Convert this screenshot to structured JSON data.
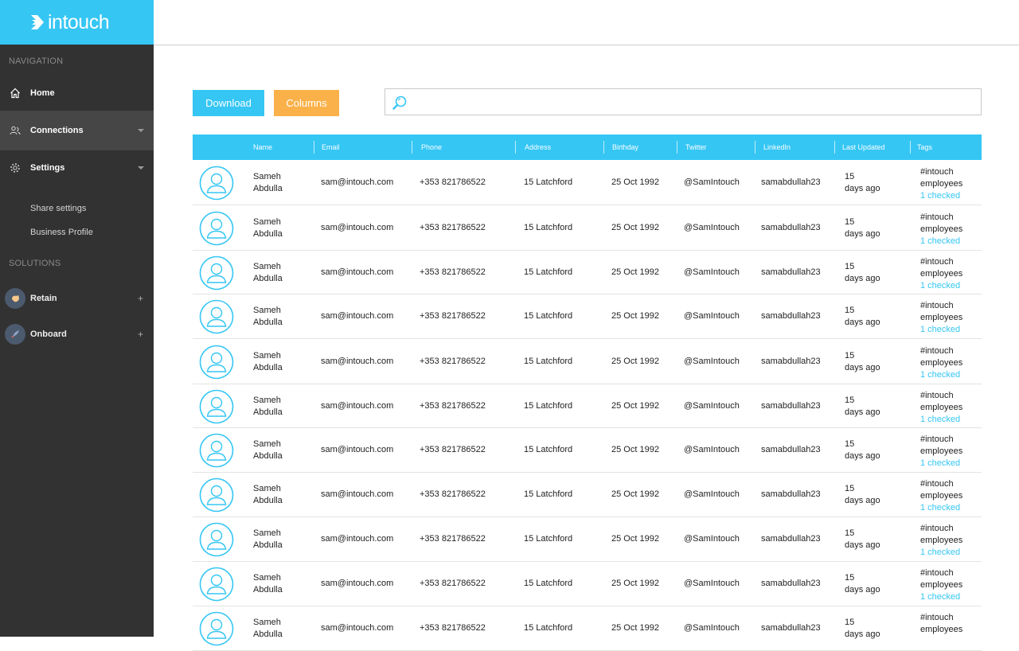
{
  "brand": {
    "name": "intouch"
  },
  "sidebar": {
    "nav_heading": "NAVIGATION",
    "items": [
      {
        "label": "Home",
        "icon": "home-icon"
      },
      {
        "label": "Connections",
        "icon": "connections-icon",
        "expandable": true
      },
      {
        "label": "Settings",
        "icon": "gear-icon",
        "expandable": true
      }
    ],
    "sub_items": [
      "Share settings",
      "Business Profile"
    ],
    "solutions_heading": "SOLUTIONS",
    "solutions": [
      {
        "label": "Retain",
        "icon": "retain-icon"
      },
      {
        "label": "Onboard",
        "icon": "rocket-icon"
      }
    ]
  },
  "toolbar": {
    "download_label": "Download",
    "columns_label": "Columns",
    "search_placeholder": ""
  },
  "table": {
    "columns": [
      "",
      "Name",
      "Email",
      "Phone",
      "Address",
      "Birthday",
      "Twitter",
      "LinkedIn",
      "Last Updated",
      "Tags"
    ],
    "rows": [
      {
        "first": "Sameh",
        "last": "Abdulla",
        "email": "sam@intouch.com",
        "phone": "+353 821786522",
        "address": "15 Latchford",
        "birthday": "25 Oct 1992",
        "twitter": "@SamIntouch",
        "linkedin": "samabdullah23",
        "updated_num": "15",
        "updated_text": "days ago",
        "tag1": "#intouch",
        "tag2": "employees",
        "tag_link": "1 checked"
      },
      {
        "first": "Sameh",
        "last": "Abdulla",
        "email": "sam@intouch.com",
        "phone": "+353 821786522",
        "address": "15 Latchford",
        "birthday": "25 Oct 1992",
        "twitter": "@SamIntouch",
        "linkedin": "samabdullah23",
        "updated_num": "15",
        "updated_text": "days ago",
        "tag1": "#intouch",
        "tag2": "employees",
        "tag_link": "1 checked"
      },
      {
        "first": "Sameh",
        "last": "Abdulla",
        "email": "sam@intouch.com",
        "phone": "+353 821786522",
        "address": "15 Latchford",
        "birthday": "25 Oct 1992",
        "twitter": "@SamIntouch",
        "linkedin": "samabdullah23",
        "updated_num": "15",
        "updated_text": "days ago",
        "tag1": "#intouch",
        "tag2": "employees",
        "tag_link": "1 checked"
      },
      {
        "first": "Sameh",
        "last": "Abdulla",
        "email": "sam@intouch.com",
        "phone": "+353 821786522",
        "address": "15 Latchford",
        "birthday": "25 Oct 1992",
        "twitter": "@SamIntouch",
        "linkedin": "samabdullah23",
        "updated_num": "15",
        "updated_text": "days ago",
        "tag1": "#intouch",
        "tag2": "employees",
        "tag_link": "1 checked"
      },
      {
        "first": "Sameh",
        "last": "Abdulla",
        "email": "sam@intouch.com",
        "phone": "+353 821786522",
        "address": "15 Latchford",
        "birthday": "25 Oct 1992",
        "twitter": "@SamIntouch",
        "linkedin": "samabdullah23",
        "updated_num": "15",
        "updated_text": "days ago",
        "tag1": "#intouch",
        "tag2": "employees",
        "tag_link": "1 checked"
      },
      {
        "first": "Sameh",
        "last": "Abdulla",
        "email": "sam@intouch.com",
        "phone": "+353 821786522",
        "address": "15 Latchford",
        "birthday": "25 Oct 1992",
        "twitter": "@SamIntouch",
        "linkedin": "samabdullah23",
        "updated_num": "15",
        "updated_text": "days ago",
        "tag1": "#intouch",
        "tag2": "employees",
        "tag_link": "1 checked"
      },
      {
        "first": "Sameh",
        "last": "Abdulla",
        "email": "sam@intouch.com",
        "phone": "+353 821786522",
        "address": "15 Latchford",
        "birthday": "25 Oct 1992",
        "twitter": "@SamIntouch",
        "linkedin": "samabdullah23",
        "updated_num": "15",
        "updated_text": "days ago",
        "tag1": "#intouch",
        "tag2": "employees",
        "tag_link": "1 checked"
      },
      {
        "first": "Sameh",
        "last": "Abdulla",
        "email": "sam@intouch.com",
        "phone": "+353 821786522",
        "address": "15 Latchford",
        "birthday": "25 Oct 1992",
        "twitter": "@SamIntouch",
        "linkedin": "samabdullah23",
        "updated_num": "15",
        "updated_text": "days ago",
        "tag1": "#intouch",
        "tag2": "employees",
        "tag_link": "1 checked"
      },
      {
        "first": "Sameh",
        "last": "Abdulla",
        "email": "sam@intouch.com",
        "phone": "+353 821786522",
        "address": "15 Latchford",
        "birthday": "25 Oct 1992",
        "twitter": "@SamIntouch",
        "linkedin": "samabdullah23",
        "updated_num": "15",
        "updated_text": "days ago",
        "tag1": "#intouch",
        "tag2": "employees",
        "tag_link": "1 checked"
      },
      {
        "first": "Sameh",
        "last": "Abdulla",
        "email": "sam@intouch.com",
        "phone": "+353 821786522",
        "address": "15 Latchford",
        "birthday": "25 Oct 1992",
        "twitter": "@SamIntouch",
        "linkedin": "samabdullah23",
        "updated_num": "15",
        "updated_text": "days ago",
        "tag1": "#intouch",
        "tag2": "employees",
        "tag_link": "1 checked"
      },
      {
        "first": "Sameh",
        "last": "Abdulla",
        "email": "sam@intouch.com",
        "phone": "+353 821786522",
        "address": "15 Latchford",
        "birthday": "25 Oct 1992",
        "twitter": "@SamIntouch",
        "linkedin": "samabdullah23",
        "updated_num": "15",
        "updated_text": "days ago",
        "tag1": "#intouch",
        "tag2": "employees",
        "tag_link": ""
      }
    ]
  },
  "colors": {
    "accent": "#35c6f4",
    "columns_button": "#fbb14a",
    "sidebar_bg": "#323232"
  }
}
